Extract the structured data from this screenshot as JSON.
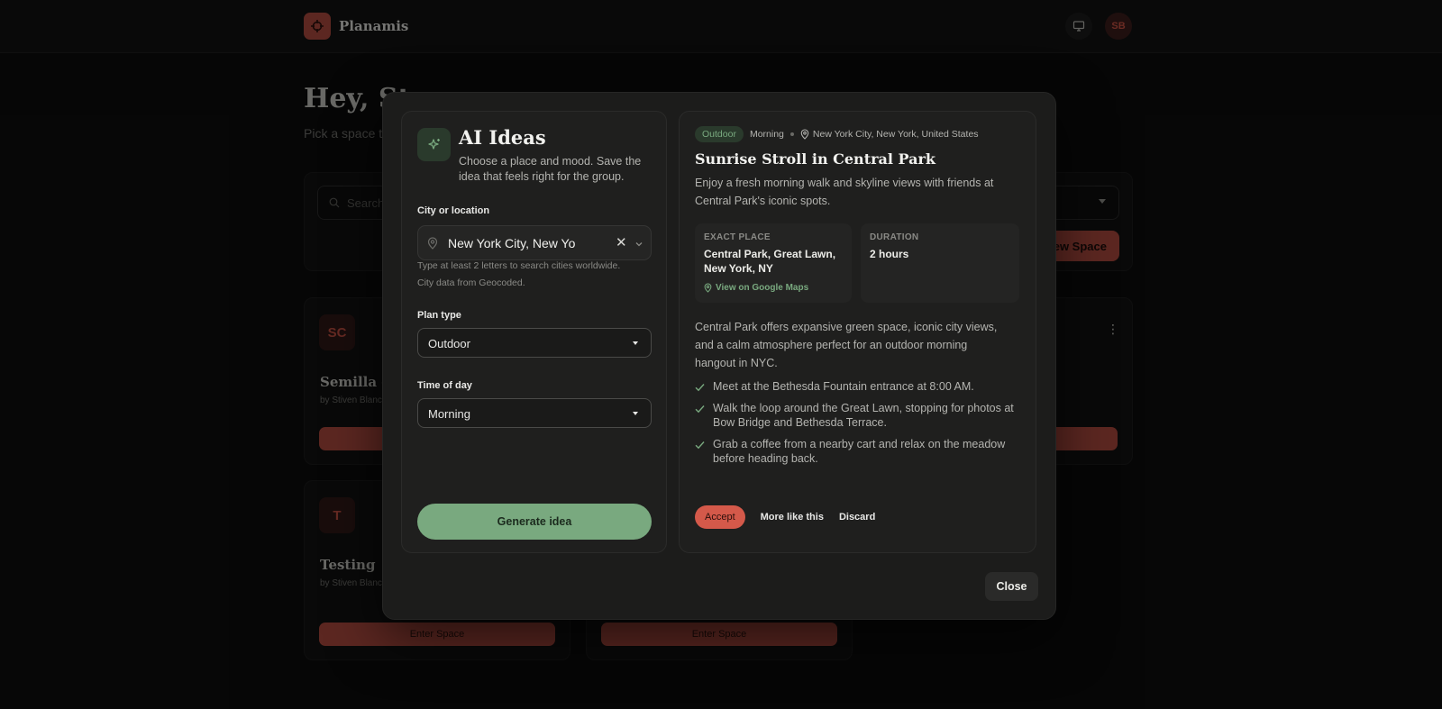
{
  "app": {
    "name": "Planamis",
    "user_initials": "SB"
  },
  "page": {
    "greeting": "Hey, St",
    "subtitle": "Pick a space t",
    "search_placeholder": "Search",
    "new_space_label": "New Space"
  },
  "cards": [
    {
      "initials": "SC",
      "title": "Semilla ca",
      "owner": "by Stiven Blanc"
    },
    {
      "initials": "T",
      "title": "Testing",
      "owner": "by Stiven Blanc",
      "enter_label": "Enter Space"
    },
    {
      "enter_label": "Enter Space"
    }
  ],
  "modal": {
    "title": "AI Ideas",
    "subtitle": "Choose a place and mood. Save the idea that feels right for the group.",
    "city_label": "City or location",
    "city_value": "New York City, New Yo",
    "city_hint": "Type at least 2 letters to search cities worldwide.",
    "city_source": "City data from Geocoded.",
    "plan_type_label": "Plan type",
    "plan_type_value": "Outdoor",
    "time_label": "Time of day",
    "time_value": "Morning",
    "generate_label": "Generate idea",
    "close_label": "Close"
  },
  "idea": {
    "tag": "Outdoor",
    "time": "Morning",
    "location": "New York City, New York, United States",
    "title": "Sunrise Stroll in Central Park",
    "description": "Enjoy a fresh morning walk and skyline views with friends at Central Park's iconic spots.",
    "exact_place_label": "EXACT PLACE",
    "exact_place_value": "Central Park, Great Lawn, New York, NY",
    "maps_label": "View on Google Maps",
    "duration_label": "DURATION",
    "duration_value": "2 hours",
    "body": "Central Park offers expansive green space, iconic city views, and a calm atmosphere perfect for an outdoor morning hangout in NYC.",
    "steps": [
      "Meet at the Bethesda Fountain entrance at 8:00 AM.",
      "Walk the loop around the Great Lawn, stopping for photos at Bow Bridge and Bethesda Terrace.",
      "Grab a coffee from a nearby cart and relax on the meadow before heading back."
    ],
    "accept_label": "Accept",
    "more_label": "More like this",
    "discard_label": "Discard"
  },
  "colors": {
    "accent_red": "#a8473c",
    "accent_green": "#79a97f",
    "accept_red": "#d4594a"
  }
}
